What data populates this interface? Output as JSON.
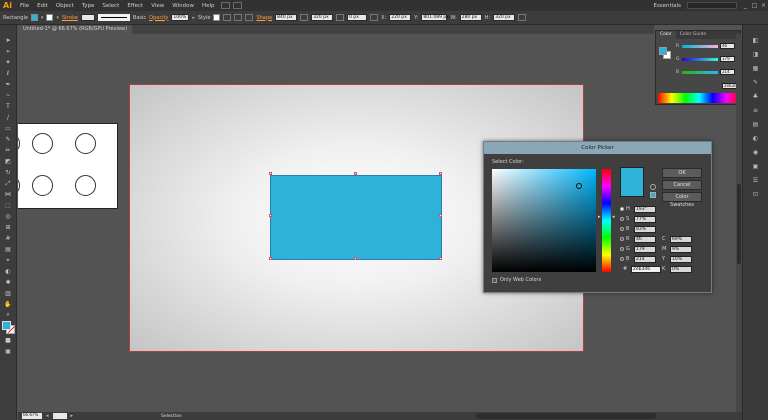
{
  "app": {
    "logo": "Ai",
    "workspace": "Essentials"
  },
  "menu": [
    "File",
    "Edit",
    "Object",
    "Type",
    "Select",
    "Effect",
    "View",
    "Window",
    "Help"
  ],
  "window_controls": [
    "_",
    "□",
    "×"
  ],
  "control_bar": {
    "tool_name": "Rectangle",
    "stroke_label": "Stroke",
    "stroke_style": "Basic",
    "opacity_label": "Opacity",
    "opacity_value": "100%",
    "style_label": "Style",
    "shape_label": "Shape",
    "width": "840 px",
    "height": "320 px",
    "corner": "0 px",
    "x": "220 px",
    "y": "801.089 px",
    "w": "280 px",
    "h": "320 px"
  },
  "document": {
    "tab_title": "Untitled-1* @ 66.67% (RGB/GPU Preview)"
  },
  "color_panel": {
    "tabs": [
      "Color",
      "Color Guide"
    ],
    "r_label": "R",
    "r_value": "46",
    "g_label": "G",
    "g_value": "179",
    "b_label": "B",
    "b_value": "214",
    "hex": "2eb3d6",
    "colors": {
      "fill": "#2eb2da"
    }
  },
  "color_picker": {
    "title": "Color Picker",
    "select_label": "Select Color:",
    "ok": "OK",
    "cancel": "Cancel",
    "swatches": "Color Swatches",
    "only_web": "Only Web Colors",
    "hsb": {
      "h_label": "H",
      "h_value": "193°",
      "s_label": "S",
      "s_value": "77%",
      "b_label": "B",
      "b_value": "83%"
    },
    "rgb": {
      "r_label": "R",
      "r_value": "46",
      "g_label": "G",
      "g_value": "179",
      "b_label": "B",
      "b_value": "214"
    },
    "cmyk": {
      "c_label": "C",
      "c_value": "69%",
      "m_label": "M",
      "m_value": "9%",
      "y_label": "Y",
      "y_value": "10%",
      "k_label": "K",
      "k_value": "0%"
    },
    "hex_label": "#",
    "hex_value": "2eb3d6"
  },
  "status": {
    "zoom": "66.67%",
    "page": "1",
    "tool": "Selection"
  }
}
